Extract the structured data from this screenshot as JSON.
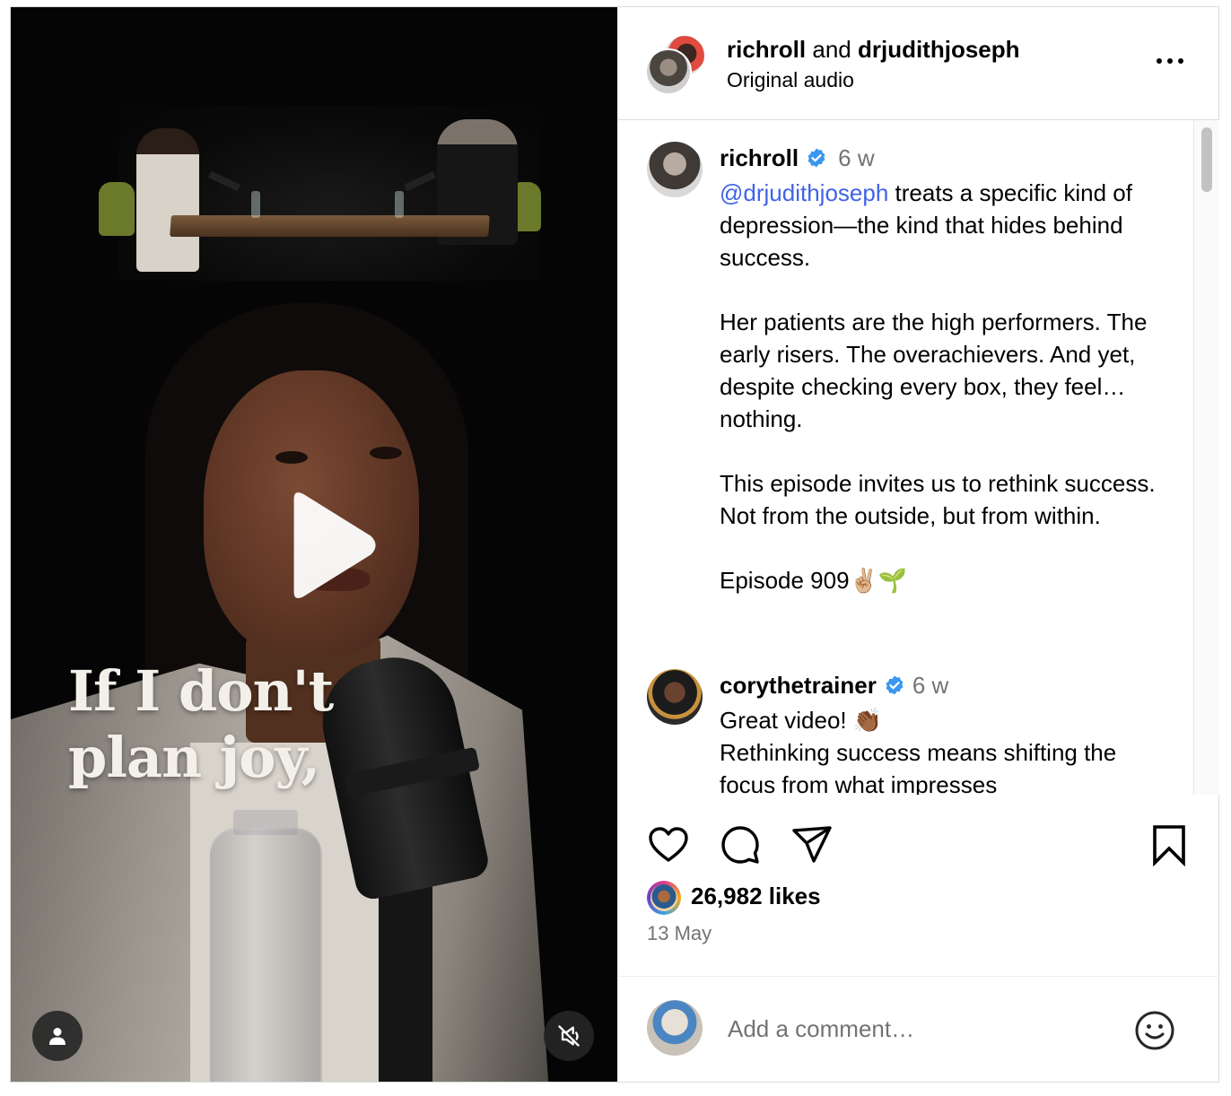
{
  "video": {
    "overlay_line1": "If I don't",
    "overlay_line2": "plan joy,",
    "play_icon": "play-icon",
    "tag_icon": "user-icon",
    "mute_icon": "muted-speaker-icon"
  },
  "header": {
    "author1": "richroll",
    "joiner": " and ",
    "author2": "drjudithjoseph",
    "audio": "Original audio",
    "more_icon": "more-horizontal-icon"
  },
  "caption": {
    "username": "richroll",
    "verified_icon": "verified-badge-icon",
    "time": "6 w",
    "mention": "@drjudithjoseph",
    "text_after_mention": " treats a specific kind of depression—the kind that hides behind success.\n\nHer patients are the high performers. The early risers. The overachievers. And yet, despite checking every box, they feel… nothing.\n\nThis episode invites us to rethink success. Not from the outside, but from within.\n\nEpisode 909✌🏼🌱"
  },
  "comments": [
    {
      "username": "corythetrainer",
      "time": "6 w",
      "text": "Great video! 👏🏾\nRethinking success means shifting the focus from what impresses"
    }
  ],
  "actions": {
    "like_icon": "heart-icon",
    "comment_icon": "comment-bubble-icon",
    "share_icon": "paper-plane-icon",
    "save_icon": "bookmark-icon"
  },
  "likes": "26,982 likes",
  "date": "13 May",
  "add_comment": {
    "placeholder": "Add a comment…",
    "emoji_icon": "emoji-icon"
  },
  "colors": {
    "mention": "#4063e6",
    "verified": "#3897f0",
    "muted_text": "#737373"
  }
}
